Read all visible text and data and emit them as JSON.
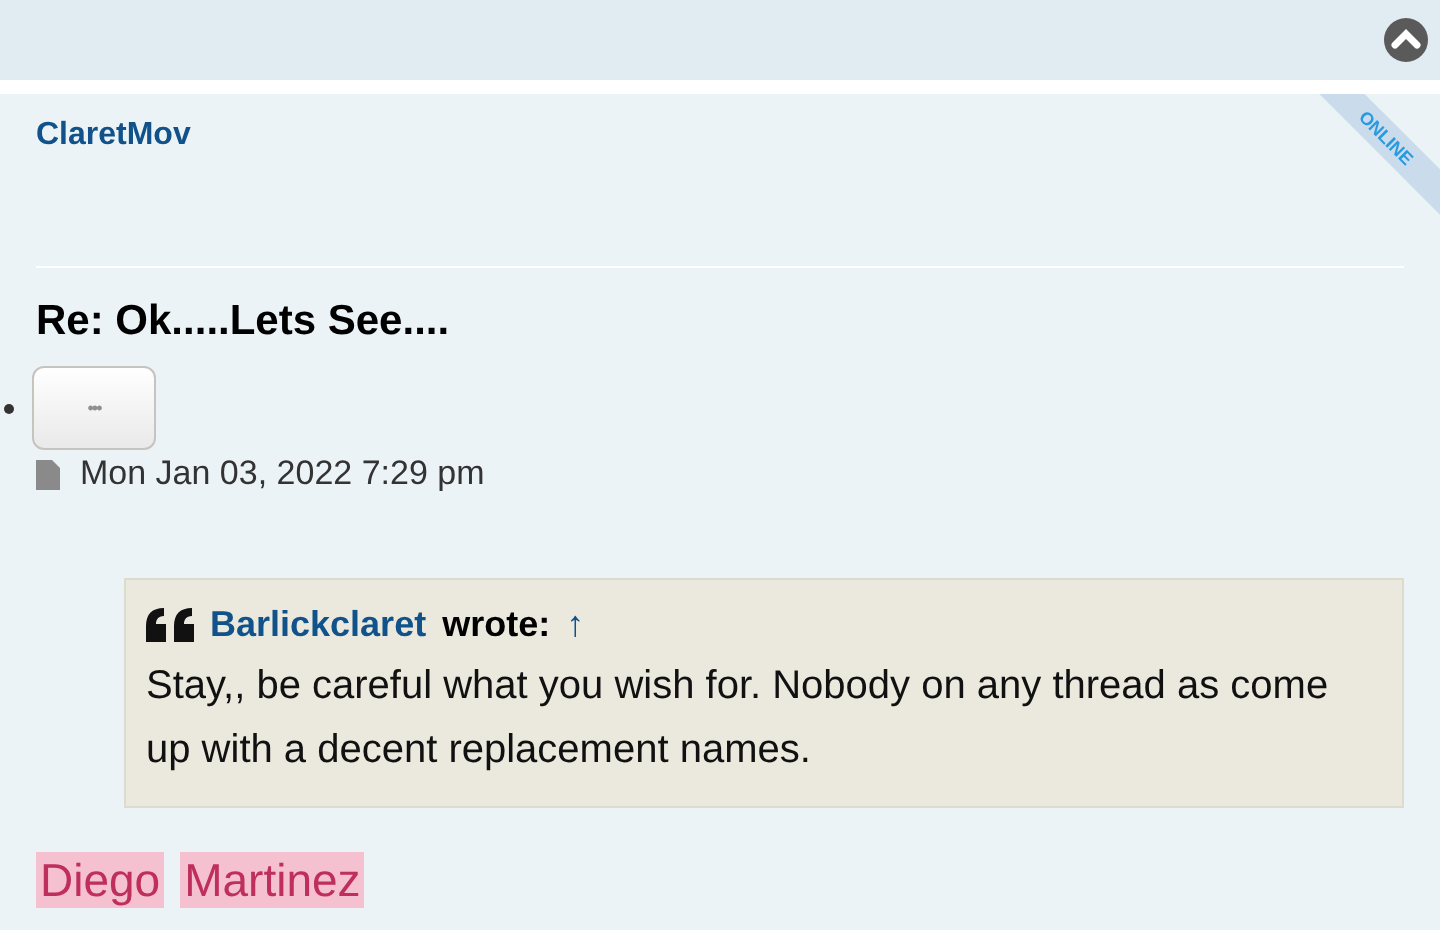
{
  "post": {
    "author": "ClaretMov",
    "online_badge": "ONLINE",
    "title": "Re: Ok.....Lets See....",
    "menu_button": "•••",
    "date": "Mon Jan 03, 2022 7:29 pm",
    "quote": {
      "author": "Barlickclaret",
      "wrote": "wrote:",
      "jump": "↑",
      "text": "Stay,, be careful what you wish for. Nobody on any thread as come up with a decent replacement names."
    },
    "highlights": [
      "Diego",
      "Martinez"
    ]
  }
}
